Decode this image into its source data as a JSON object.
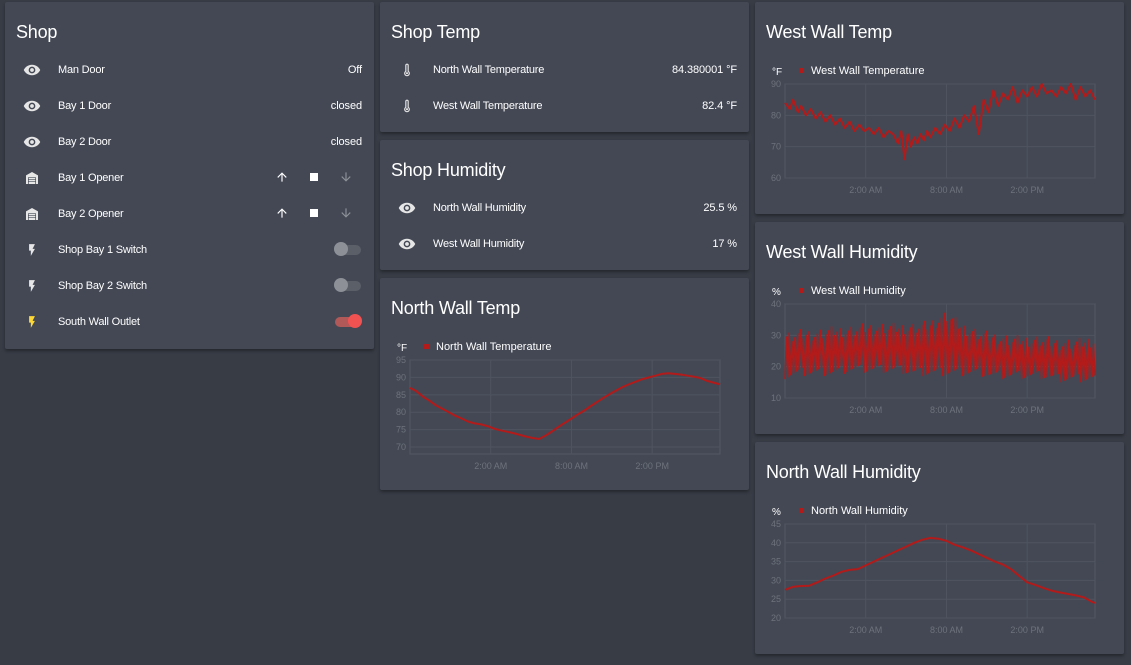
{
  "colors": {
    "accent": "#f05252",
    "series": "#b31a1a",
    "lightning_on": "#fdd835"
  },
  "shop": {
    "title": "Shop",
    "rows": [
      {
        "label": "Man Door",
        "icon": "eye-icon",
        "state": "Off",
        "kind": "state"
      },
      {
        "label": "Bay 1 Door",
        "icon": "eye-icon",
        "state": "closed",
        "kind": "state"
      },
      {
        "label": "Bay 2 Door",
        "icon": "eye-icon",
        "state": "closed",
        "kind": "state"
      },
      {
        "label": "Bay 1 Opener",
        "icon": "garage-icon",
        "kind": "cover"
      },
      {
        "label": "Bay 2 Opener",
        "icon": "garage-icon",
        "kind": "cover"
      },
      {
        "label": "Shop Bay 1 Switch",
        "icon": "lightning-icon",
        "kind": "toggle",
        "on": false
      },
      {
        "label": "Shop Bay 2 Switch",
        "icon": "lightning-icon",
        "kind": "toggle",
        "on": false
      },
      {
        "label": "South Wall Outlet",
        "icon": "lightning-icon",
        "kind": "toggle",
        "on": true
      }
    ]
  },
  "shop_temp": {
    "title": "Shop Temp",
    "rows": [
      {
        "label": "North Wall Temperature",
        "icon": "thermometer-icon",
        "state": "84.380001 °F"
      },
      {
        "label": "West Wall Temperature",
        "icon": "thermometer-icon",
        "state": "82.4 °F"
      }
    ]
  },
  "shop_humidity": {
    "title": "Shop Humidity",
    "rows": [
      {
        "label": "North Wall Humidity",
        "icon": "eye-icon",
        "state": "25.5 %"
      },
      {
        "label": "West Wall Humidity",
        "icon": "eye-icon",
        "state": "17 %"
      }
    ]
  },
  "chart_data": [
    {
      "id": "north_temp",
      "type": "line",
      "title": "North Wall Temp",
      "unit": "°F",
      "series": [
        {
          "name": "North Wall Temperature",
          "x": [
            0,
            0.4,
            0.8,
            1.2,
            1.6,
            2.0,
            2.4,
            2.8,
            3.2,
            3.6,
            4.0,
            4.4,
            4.8,
            5.2,
            5.6,
            6.0,
            6.4,
            6.8,
            7.2,
            7.6,
            8.0,
            8.4,
            8.8,
            9.2,
            9.6,
            10.0,
            10.4,
            10.8,
            11.2,
            11.6,
            12.0,
            12.4,
            12.8,
            13.2,
            13.6,
            14.0,
            14.4,
            14.8,
            15.2,
            15.6,
            16.0,
            16.4,
            16.8,
            17.2,
            17.6,
            18.0,
            18.4,
            18.8,
            19.2
          ],
          "y": [
            87,
            86,
            84.5,
            83.3,
            82,
            81,
            80,
            79,
            78.2,
            77.3,
            76.8,
            76.5,
            76,
            75.3,
            74.8,
            74.4,
            74,
            73.5,
            73,
            72.6,
            72.3,
            73.3,
            74.5,
            75.8,
            77,
            78.2,
            79.4,
            80.5,
            81.8,
            83,
            84.2,
            85.3,
            86.3,
            87.3,
            88.1,
            88.8,
            89.5,
            90,
            90.5,
            91,
            91.2,
            91,
            90.8,
            90.5,
            90.2,
            89.8,
            89,
            88.5,
            88
          ]
        }
      ],
      "yticks": [
        70,
        75,
        80,
        85,
        90,
        95
      ],
      "ylim": [
        68,
        95
      ],
      "xlim": [
        0,
        19.2
      ],
      "xticks": [
        {
          "x": 5.0,
          "label": "2:00 AM"
        },
        {
          "x": 10.0,
          "label": "8:00 AM"
        },
        {
          "x": 15.0,
          "label": "2:00 PM"
        }
      ]
    },
    {
      "id": "west_temp",
      "type": "line",
      "title": "West Wall Temp",
      "unit": "°F",
      "series": [
        {
          "name": "West Wall Temperature",
          "x": [
            0,
            0.3,
            0.5,
            0.8,
            1.0,
            1.3,
            1.6,
            1.9,
            2.2,
            2.5,
            2.8,
            3.1,
            3.4,
            3.7,
            4.0,
            4.3,
            4.6,
            4.9,
            5.2,
            5.5,
            5.8,
            6.1,
            6.4,
            6.7,
            7.0,
            7.2,
            7.4,
            7.6,
            7.8,
            8.0,
            8.2,
            8.4,
            8.6,
            8.8,
            9.0,
            9.3,
            9.6,
            9.9,
            10.2,
            10.5,
            10.8,
            11.1,
            11.4,
            11.7,
            12.0,
            12.3,
            12.6,
            12.9,
            13.2,
            13.5,
            13.8,
            14.1,
            14.4,
            14.7,
            15.0,
            15.3,
            15.6,
            15.9,
            16.2,
            16.5,
            16.8,
            17.1,
            17.4,
            17.7,
            18.0,
            18.3,
            18.6,
            18.9,
            19.2
          ],
          "y": [
            84,
            82,
            85,
            81,
            83,
            80,
            82,
            79,
            81,
            78,
            80,
            77,
            79,
            76,
            78,
            75,
            77,
            75,
            76,
            74,
            76,
            73,
            75,
            74,
            71,
            75,
            66,
            74,
            70,
            73,
            71,
            74,
            72,
            75,
            73,
            76,
            74,
            77,
            75,
            79,
            76,
            80,
            78,
            83,
            74,
            85,
            81,
            88,
            83,
            87,
            85,
            89,
            84,
            88,
            86,
            89,
            86,
            90,
            87,
            88,
            86,
            89,
            87,
            90,
            85,
            89,
            86,
            88,
            85
          ]
        }
      ],
      "yticks": [
        60,
        70,
        80,
        90
      ],
      "ylim": [
        60,
        90
      ],
      "xlim": [
        0,
        19.2
      ],
      "xticks": [
        {
          "x": 5.0,
          "label": "2:00 AM"
        },
        {
          "x": 10.0,
          "label": "8:00 AM"
        },
        {
          "x": 15.0,
          "label": "2:00 PM"
        }
      ]
    },
    {
      "id": "west_hum",
      "type": "line",
      "title": "West Wall Humidity",
      "unit": "%",
      "series": [
        {
          "name": "West Wall Humidity",
          "band_x": [
            0,
            1,
            2,
            3,
            4,
            5,
            6,
            7,
            8,
            9,
            10,
            11,
            12,
            13,
            14,
            15,
            16,
            17,
            18,
            19.2
          ],
          "band_low": [
            16,
            17,
            17,
            17,
            18,
            18,
            18,
            18,
            17,
            17,
            17,
            17,
            17,
            16,
            16,
            16,
            16,
            15,
            15,
            15
          ],
          "band_high": [
            31,
            32,
            32,
            33,
            33,
            34,
            34,
            34,
            34,
            35,
            38,
            34,
            32,
            31,
            30,
            30,
            30,
            29,
            29,
            30
          ]
        }
      ],
      "yticks": [
        10,
        20,
        30,
        40
      ],
      "ylim": [
        10,
        40
      ],
      "xlim": [
        0,
        19.2
      ],
      "xticks": [
        {
          "x": 5.0,
          "label": "2:00 AM"
        },
        {
          "x": 10.0,
          "label": "8:00 AM"
        },
        {
          "x": 15.0,
          "label": "2:00 PM"
        }
      ]
    },
    {
      "id": "north_hum",
      "type": "line",
      "title": "North Wall Humidity",
      "unit": "%",
      "series": [
        {
          "name": "North Wall Humidity",
          "x": [
            0,
            0.5,
            1.0,
            1.5,
            2.0,
            2.5,
            3.0,
            3.5,
            4.0,
            4.5,
            5.0,
            5.5,
            6.0,
            6.5,
            7.0,
            7.5,
            8.0,
            8.5,
            9.0,
            9.5,
            10.0,
            10.5,
            11.0,
            11.5,
            12.0,
            12.5,
            13.0,
            13.5,
            14.0,
            14.5,
            15.0,
            15.5,
            16.0,
            16.5,
            17.0,
            17.5,
            18.0,
            18.5,
            19.0,
            19.2
          ],
          "y": [
            27.5,
            28.3,
            28.5,
            28.6,
            29.5,
            30.5,
            31.3,
            32.3,
            32.8,
            33,
            34,
            35,
            36,
            37,
            38,
            39,
            40,
            40.8,
            41.3,
            41.1,
            40.5,
            39.5,
            38.8,
            38,
            37,
            36,
            35,
            34.2,
            33,
            31.2,
            29.5,
            28.8,
            28,
            27.3,
            26.8,
            26.4,
            26,
            25.5,
            24.3,
            24
          ]
        }
      ],
      "yticks": [
        20,
        25,
        30,
        35,
        40,
        45
      ],
      "ylim": [
        20,
        45
      ],
      "xlim": [
        0,
        19.2
      ],
      "xticks": [
        {
          "x": 5.0,
          "label": "2:00 AM"
        },
        {
          "x": 10.0,
          "label": "8:00 AM"
        },
        {
          "x": 15.0,
          "label": "2:00 PM"
        }
      ]
    }
  ]
}
